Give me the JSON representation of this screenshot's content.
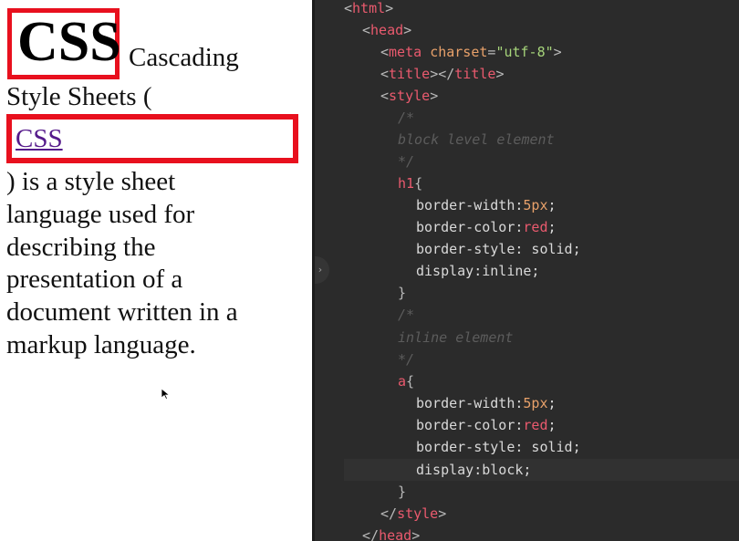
{
  "preview": {
    "heading": "CSS",
    "line1": "Cascading",
    "line2": "Style Sheets (",
    "link_text": "CSS",
    "lines": [
      ") is a style sheet",
      "language used for",
      "describing the",
      "presentation of a",
      "document written in a",
      "markup language."
    ]
  },
  "editor": {
    "collapse_glyph": "›",
    "code": {
      "html_open": "html",
      "head_open": "head",
      "meta_tag": "meta",
      "meta_attr": "charset",
      "meta_val": "\"utf-8\"",
      "title_tag": "title",
      "style_tag": "style",
      "c1_open": "/*",
      "c1_text": "block level element",
      "c1_close": "*/",
      "sel_h1": "h1",
      "h1_p1": "border-width:",
      "h1_v1": "5px",
      "h1_p2": "border-color:",
      "h1_v2": "red",
      "h1_p3": "border-style: solid;",
      "h1_p4": "display:inline;",
      "c2_open": "/*",
      "c2_text": "inline element",
      "c2_close": "*/",
      "sel_a": "a",
      "a_p1": "border-width:",
      "a_v1": "5px",
      "a_p2": "border-color:",
      "a_v2": "red",
      "a_p3": "border-style: solid;",
      "a_p4": "display:block;",
      "style_close": "style",
      "head_close": "head"
    }
  }
}
